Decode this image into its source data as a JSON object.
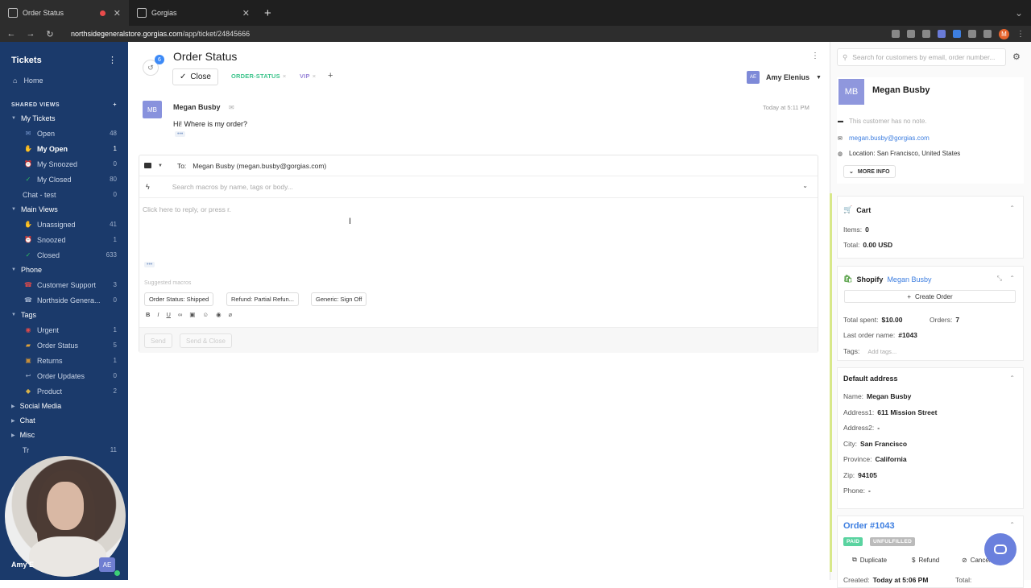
{
  "browser": {
    "tabs": [
      {
        "title": "Order Status"
      },
      {
        "title": "Gorgias"
      }
    ],
    "url_host": "northsidegeneralstore.gorgias.com",
    "url_path": "/app/ticket/24845666",
    "profile_initial": "M"
  },
  "sidebar": {
    "title": "Tickets",
    "home": "Home",
    "shared_views": "SHARED VIEWS",
    "groups": [
      {
        "label": "My Tickets",
        "items": [
          {
            "label": "Open",
            "count": "48",
            "icon": "envelope-icon"
          },
          {
            "label": "My Open",
            "count": "1",
            "icon": "wave-icon",
            "active": true
          },
          {
            "label": "My Snoozed",
            "count": "0",
            "icon": "clock-icon"
          },
          {
            "label": "My Closed",
            "count": "80",
            "icon": "check-icon"
          },
          {
            "label": "Chat - test",
            "count": "0",
            "icon": ""
          }
        ]
      },
      {
        "label": "Main Views",
        "items": [
          {
            "label": "Unassigned",
            "count": "41",
            "icon": "wave-icon"
          },
          {
            "label": "Snoozed",
            "count": "1",
            "icon": "clock-icon"
          },
          {
            "label": "Closed",
            "count": "633",
            "icon": "check-icon"
          }
        ]
      },
      {
        "label": "Phone",
        "items": [
          {
            "label": "Customer Support",
            "count": "3",
            "icon": "phone-red-icon"
          },
          {
            "label": "Northside Genera...",
            "count": "0",
            "icon": "phone-icon"
          }
        ]
      },
      {
        "label": "Tags",
        "items": [
          {
            "label": "Urgent",
            "count": "1",
            "icon": "siren-icon"
          },
          {
            "label": "Order Status",
            "count": "5",
            "icon": "truck-icon"
          },
          {
            "label": "Returns",
            "count": "1",
            "icon": "box-icon"
          },
          {
            "label": "Order Updates",
            "count": "0",
            "icon": "arrow-icon"
          },
          {
            "label": "Product",
            "count": "2",
            "icon": "bag-icon"
          }
        ]
      }
    ],
    "collapsed": [
      "Social Media",
      "Chat",
      "Misc"
    ],
    "partial_item": {
      "label": "Tr",
      "count": "11"
    },
    "footer_name": "Amy E",
    "footer_avatar": "AE"
  },
  "ticket": {
    "history_count": "6",
    "title": "Order Status",
    "close_label": "Close",
    "tags": [
      "ORDER-STATUS",
      "VIP"
    ],
    "assignee": {
      "initials": "AE",
      "name": "Amy Elenius"
    },
    "message": {
      "initials": "MB",
      "author": "Megan Busby",
      "time": "Today at 5:11 PM",
      "body": "Hi! Where is my order?"
    }
  },
  "composer": {
    "to_label": "To:",
    "to_value": "Megan Busby (megan.busby@gorgias.com)",
    "macro_placeholder": "Search macros by name, tags or body...",
    "reply_placeholder": "Click here to reply, or press r.",
    "suggested_label": "Suggested macros",
    "suggested": [
      "Order Status: Shipped",
      "Refund: Partial Refun...",
      "Generic: Sign Off"
    ],
    "send": "Send",
    "send_close": "Send & Close"
  },
  "customer": {
    "initials": "MB",
    "name": "Megan Busby",
    "note": "This customer has no note.",
    "email": "megan.busby@gorgias.com",
    "location": "Location: San Francisco, United States",
    "more_info": "MORE INFO"
  },
  "cart": {
    "title": "Cart",
    "items_label": "Items:",
    "items_value": "0",
    "total_label": "Total:",
    "total_value": "0.00 USD"
  },
  "shopify": {
    "title": "Shopify",
    "customer_link": "Megan Busby",
    "create_order": "Create Order",
    "total_spent_label": "Total spent:",
    "total_spent": "$10.00",
    "orders_label": "Orders:",
    "orders": "7",
    "last_order_label": "Last order name:",
    "last_order": "#1043",
    "tags_label": "Tags:",
    "tags_placeholder": "Add tags..."
  },
  "address": {
    "title": "Default address",
    "rows": [
      {
        "label": "Name:",
        "value": "Megan Busby"
      },
      {
        "label": "Address1:",
        "value": "611 Mission Street"
      },
      {
        "label": "Address2:",
        "value": "-"
      },
      {
        "label": "City:",
        "value": "San Francisco"
      },
      {
        "label": "Province:",
        "value": "California"
      },
      {
        "label": "Zip:",
        "value": "94105"
      },
      {
        "label": "Phone:",
        "value": "-"
      }
    ]
  },
  "order": {
    "title": "Order #1043",
    "paid": "PAID",
    "fulfillment": "UNFULFILLED",
    "duplicate": "Duplicate",
    "refund": "Refund",
    "cancel": "Cancel",
    "created_label": "Created:",
    "created_value": "Today at 5:06 PM",
    "total_label": "Total:"
  },
  "search_placeholder": "Search for customers by email, order number...",
  "colors": {
    "sidebar": "#1b3a6b",
    "accent": "#3d7ee0",
    "tag_order": "#3cc48b",
    "tag_vip": "#9a86d8"
  }
}
